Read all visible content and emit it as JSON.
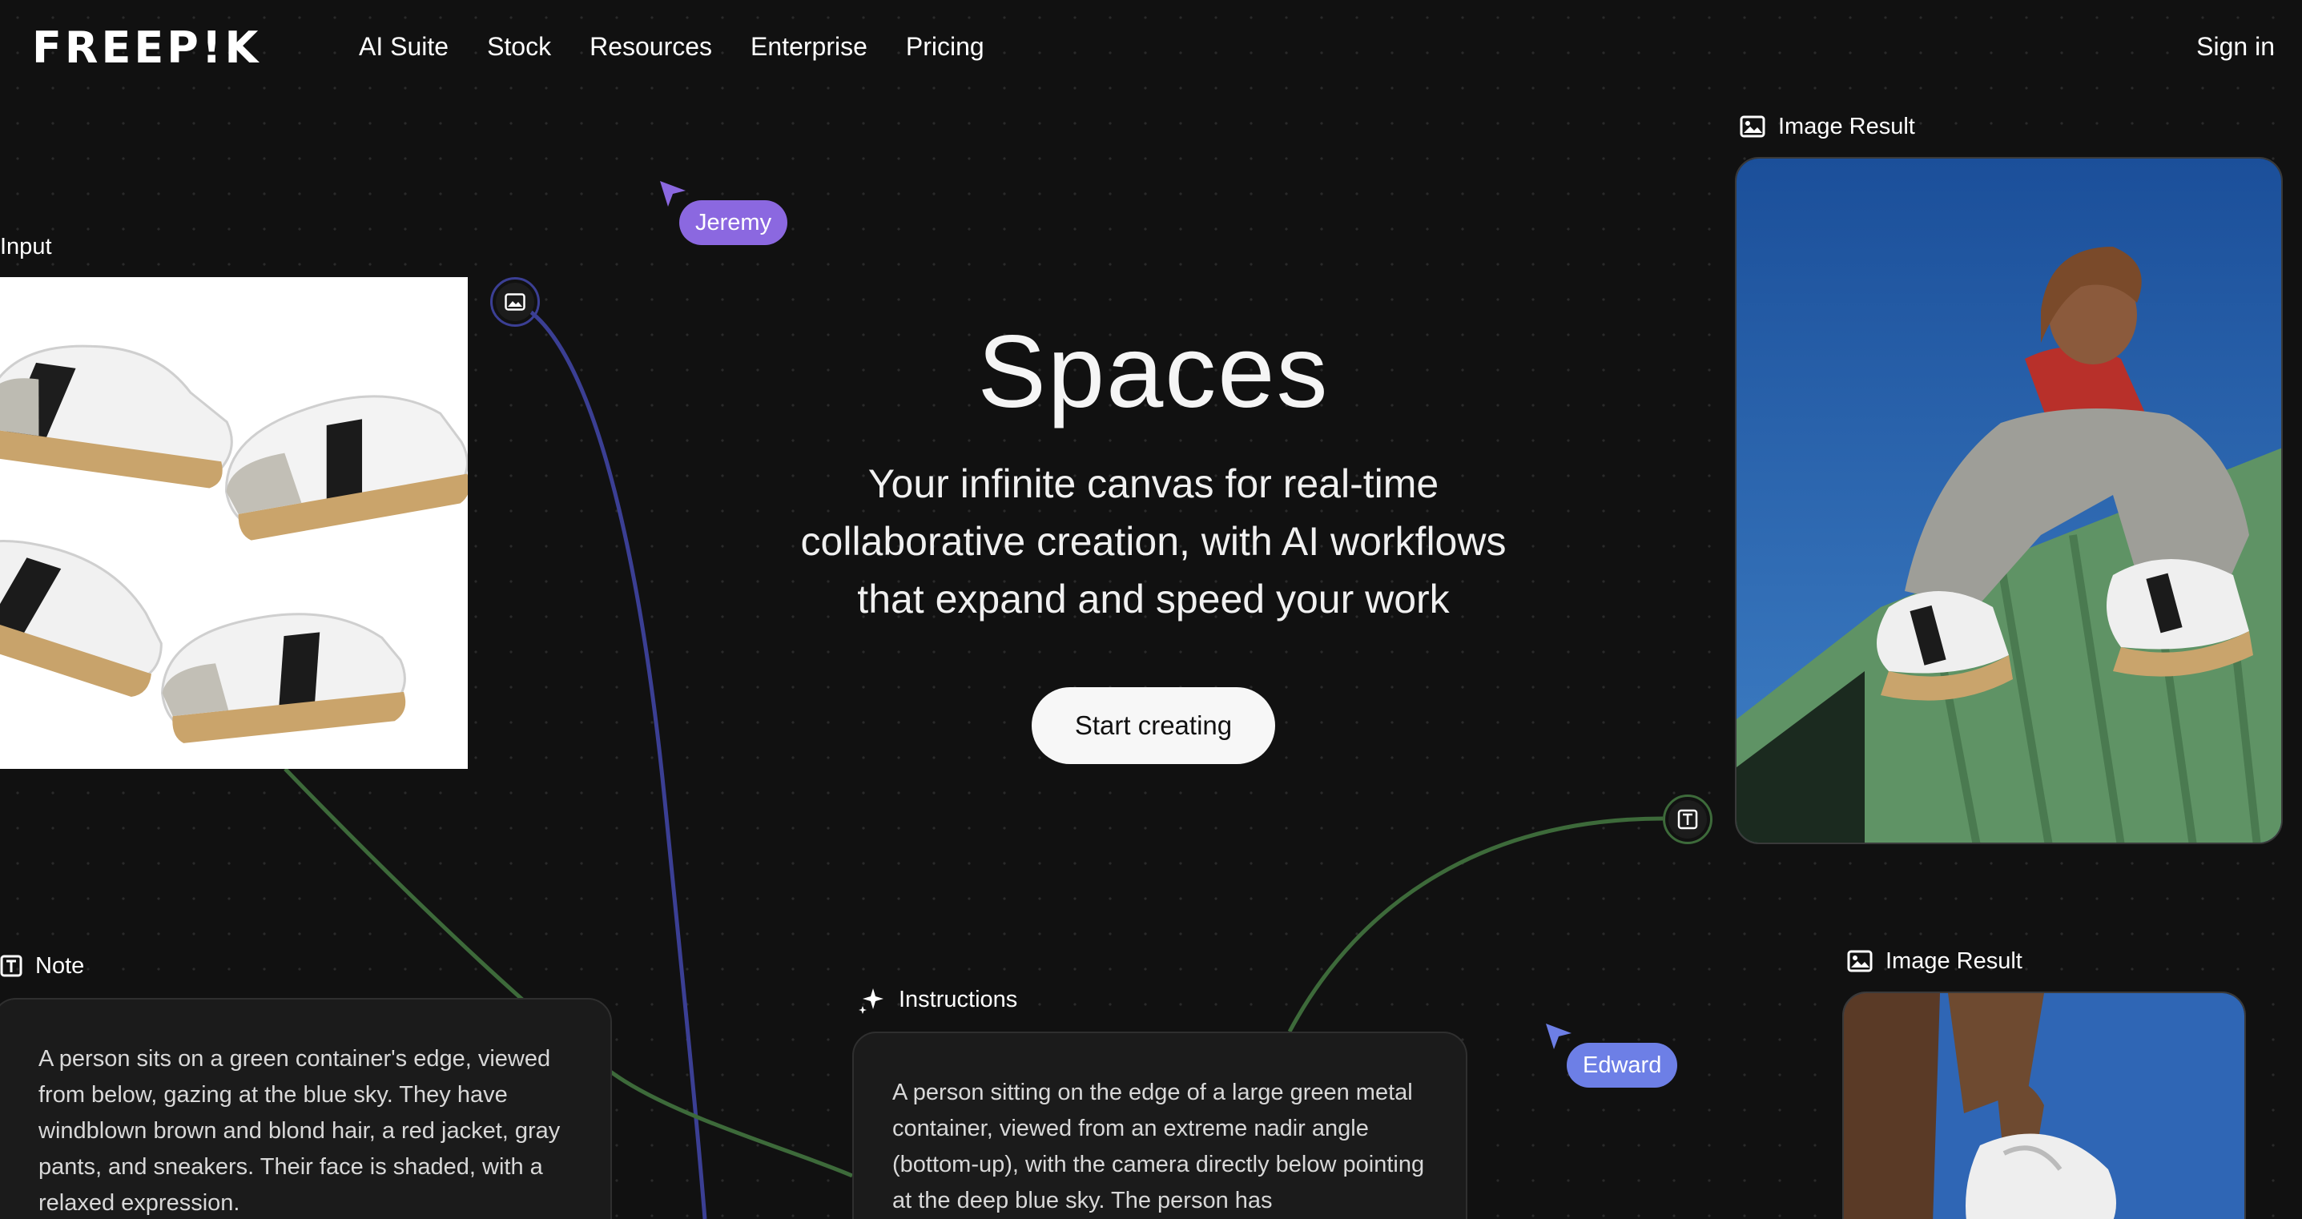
{
  "brand": {
    "logo_text": "FREEP!K"
  },
  "nav": {
    "items": [
      "AI Suite",
      "Stock",
      "Resources",
      "Enterprise",
      "Pricing"
    ],
    "sign_in": "Sign in"
  },
  "hero": {
    "title": "Spaces",
    "subtitle_lines": [
      "Your infinite canvas for real-time",
      "collaborative creation, with AI workflows",
      "that expand and speed your work"
    ],
    "cta": "Start creating"
  },
  "canvas": {
    "input_node": {
      "label": "Input"
    },
    "result_node_1": {
      "label": "Image Result"
    },
    "result_node_2": {
      "label": "Image Result"
    },
    "note_node": {
      "label": "Note",
      "text": "A person sits on a green container's edge, viewed from below, gazing at the blue sky. They have windblown brown and blond hair, a red jacket, gray pants, and sneakers. Their face is shaded, with a relaxed expression."
    },
    "instructions_node": {
      "label": "Instructions",
      "text": "A person sitting on the edge of a large green metal container, viewed from an extreme nadir angle (bottom-up), with the camera directly below pointing at the deep blue sky. The person has"
    },
    "collaborators": [
      {
        "name": "Jeremy",
        "color": "#8b68e0"
      },
      {
        "name": "Edward",
        "color": "#6d7fe6"
      }
    ]
  },
  "colors": {
    "background": "#111111",
    "wire_blue": "#3a3f8f",
    "wire_green": "#3f6b3c",
    "cta_bg": "#f7f7f7"
  },
  "icons": [
    "image-icon",
    "text-icon",
    "sparkle-icon",
    "cursor-arrow-icon"
  ]
}
